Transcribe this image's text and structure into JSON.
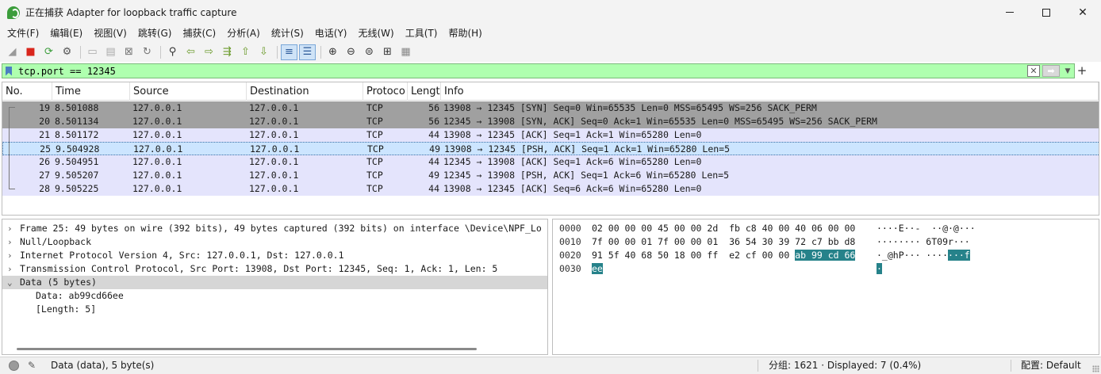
{
  "window": {
    "title": "正在捕获 Adapter for loopback traffic capture",
    "minimize": "",
    "maximize": "",
    "close": "✕"
  },
  "menu": [
    "文件(F)",
    "编辑(E)",
    "视图(V)",
    "跳转(G)",
    "捕获(C)",
    "分析(A)",
    "统计(S)",
    "电话(Y)",
    "无线(W)",
    "工具(T)",
    "帮助(H)"
  ],
  "toolbar": {
    "icons": [
      "shark-fin-start-icon",
      "stop-capture-icon",
      "restart-capture-icon",
      "capture-options-icon",
      "open-file-icon",
      "save-file-icon",
      "close-file-icon",
      "reload-file-icon",
      "find-packet-icon",
      "go-back-icon",
      "go-forward-icon",
      "go-to-packet-icon",
      "first-packet-icon",
      "last-packet-icon",
      "auto-scroll-icon",
      "colorize-icon",
      "zoom-in-icon",
      "zoom-out-icon",
      "normal-size-icon",
      "resize-columns-icon",
      "layout-icon"
    ]
  },
  "filter": {
    "value": "tcp.port == 12345",
    "clear": "✕",
    "apply": "➡",
    "dropdown": "▼",
    "add": "+"
  },
  "packet_list": {
    "columns": [
      "No.",
      "Time",
      "Source",
      "Destination",
      "Protoco",
      "Lengt",
      "Info"
    ],
    "rows": [
      {
        "no": "19",
        "time": "8.501088",
        "src": "127.0.0.1",
        "dst": "127.0.0.1",
        "proto": "TCP",
        "len": "56",
        "info": "13908 → 12345 [SYN] Seq=0 Win=65535 Len=0 MSS=65495 WS=256 SACK_PERM",
        "style": "syn"
      },
      {
        "no": "20",
        "time": "8.501134",
        "src": "127.0.0.1",
        "dst": "127.0.0.1",
        "proto": "TCP",
        "len": "56",
        "info": "12345 → 13908 [SYN, ACK] Seq=0 Ack=1 Win=65535 Len=0 MSS=65495 WS=256 SACK_PERM",
        "style": "syn"
      },
      {
        "no": "21",
        "time": "8.501172",
        "src": "127.0.0.1",
        "dst": "127.0.0.1",
        "proto": "TCP",
        "len": "44",
        "info": "13908 → 12345 [ACK] Seq=1 Ack=1 Win=65280 Len=0",
        "style": "normal"
      },
      {
        "no": "25",
        "time": "9.504928",
        "src": "127.0.0.1",
        "dst": "127.0.0.1",
        "proto": "TCP",
        "len": "49",
        "info": "13908 → 12345 [PSH, ACK] Seq=1 Ack=1 Win=65280 Len=5",
        "style": "selected"
      },
      {
        "no": "26",
        "time": "9.504951",
        "src": "127.0.0.1",
        "dst": "127.0.0.1",
        "proto": "TCP",
        "len": "44",
        "info": "12345 → 13908 [ACK] Seq=1 Ack=6 Win=65280 Len=0",
        "style": "normal"
      },
      {
        "no": "27",
        "time": "9.505207",
        "src": "127.0.0.1",
        "dst": "127.0.0.1",
        "proto": "TCP",
        "len": "49",
        "info": "12345 → 13908 [PSH, ACK] Seq=1 Ack=6 Win=65280 Len=5",
        "style": "normal"
      },
      {
        "no": "28",
        "time": "9.505225",
        "src": "127.0.0.1",
        "dst": "127.0.0.1",
        "proto": "TCP",
        "len": "44",
        "info": "13908 → 12345 [ACK] Seq=6 Ack=6 Win=65280 Len=0",
        "style": "normal"
      }
    ]
  },
  "details": [
    {
      "caret": "›",
      "text": "Frame 25: 49 bytes on wire (392 bits), 49 bytes captured (392 bits) on interface \\Device\\NPF_Lo",
      "child": false,
      "selected": false
    },
    {
      "caret": "›",
      "text": "Null/Loopback",
      "child": false,
      "selected": false
    },
    {
      "caret": "›",
      "text": "Internet Protocol Version 4, Src: 127.0.0.1, Dst: 127.0.0.1",
      "child": false,
      "selected": false
    },
    {
      "caret": "›",
      "text": "Transmission Control Protocol, Src Port: 13908, Dst Port: 12345, Seq: 1, Ack: 1, Len: 5",
      "child": false,
      "selected": false
    },
    {
      "caret": "⌄",
      "text": "Data (5 bytes)",
      "child": false,
      "selected": true
    },
    {
      "caret": "",
      "text": "Data: ab99cd66ee",
      "child": true,
      "selected": false
    },
    {
      "caret": "",
      "text": "[Length: 5]",
      "child": true,
      "selected": false
    }
  ],
  "bytes": [
    {
      "offset": "0000",
      "hex": "02 00 00 00 45 00 00 2d  fb c8 40 00 40 06 00 00",
      "hex_hl": "",
      "ascii": "····E··-  ··@·@···",
      "ascii_hl": ""
    },
    {
      "offset": "0010",
      "hex": "7f 00 00 01 7f 00 00 01  36 54 30 39 72 c7 bb d8",
      "hex_hl": "",
      "ascii": "········ 6T09r···",
      "ascii_hl": ""
    },
    {
      "offset": "0020",
      "hex": "91 5f 40 68 50 18 00 ff  e2 cf 00 00 ",
      "hex_hl": "ab 99 cd 66",
      "ascii": "·_@hP··· ····",
      "ascii_hl": "···f"
    },
    {
      "offset": "0030",
      "hex": "",
      "hex_hl": "ee",
      "ascii": "",
      "ascii_hl": "·"
    }
  ],
  "status": {
    "text": "Data (data), 5 byte(s)",
    "count": "分组: 1621 · Displayed: 7 (0.4%)",
    "profile": "配置:   Default"
  }
}
